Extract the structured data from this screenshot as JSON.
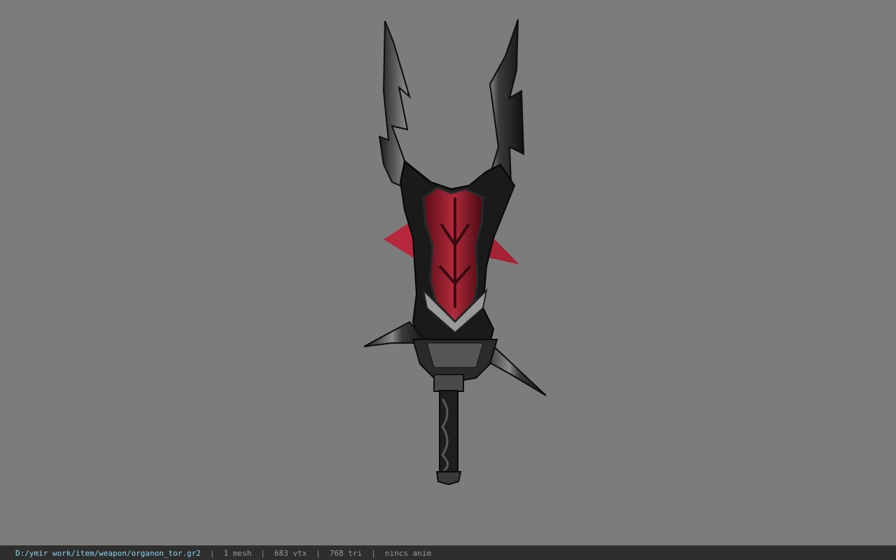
{
  "viewport": {
    "background": "#7c7c7c",
    "model_icon": "weapon-model"
  },
  "status": {
    "file_path": "D:/ymir work/item/weapon/organon_tor.gr2",
    "separator": "|",
    "mesh_count": "1 mesh",
    "vertex_count": "683 vtx",
    "triangle_count": "768 tri",
    "anim_status": "nincs anim",
    "path_color": "#8fd3f0"
  }
}
